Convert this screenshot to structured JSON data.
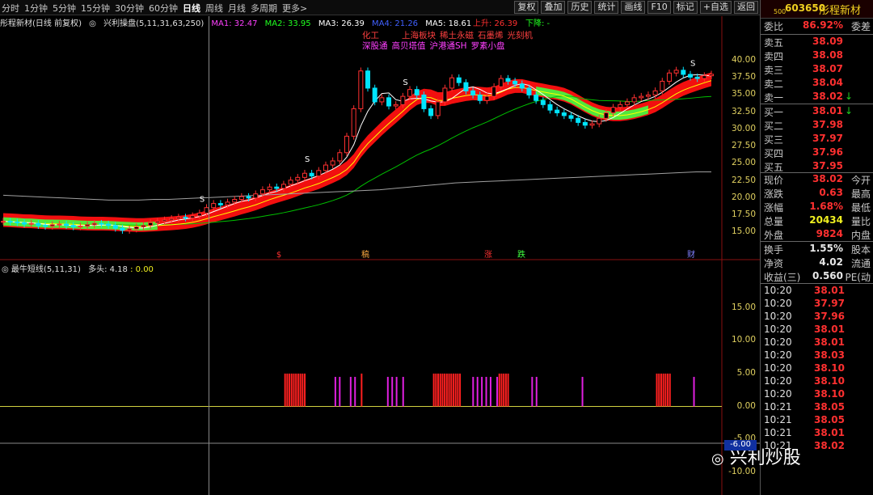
{
  "toolbar": {
    "timeframes": [
      "分时",
      "1分钟",
      "5分钟",
      "15分钟",
      "30分钟",
      "60分钟",
      "日线",
      "周线",
      "月线",
      "多周期",
      "更多>"
    ],
    "active": "日线",
    "right_buttons": [
      "复权",
      "叠加",
      "历史",
      "统计",
      "画线",
      "F10",
      "标记",
      "+自选",
      "返回"
    ]
  },
  "legend": {
    "stock_title": "彤程新材(日线 前复权)",
    "indicator": "兴利操盘(5,11,31,63,250)",
    "ma1": "MA1: 32.47",
    "ma2": "MA2: 33.95",
    "ma3": "MA3: 26.39",
    "ma4": "MA4: 21.26",
    "ma5": "MA5: 18.61",
    "up": "上升: 26.39",
    "down": "下降: -"
  },
  "news": {
    "line1": [
      "化工",
      "上海板块",
      "稀土永磁",
      "石墨烯",
      "光刻机"
    ],
    "line2": [
      "深股通",
      "高贝塔值",
      "沪港通SH",
      "罗素小盘"
    ]
  },
  "price_axis": [
    "40.00",
    "37.50",
    "35.00",
    "32.50",
    "30.00",
    "27.50",
    "25.00",
    "22.50",
    "20.00",
    "17.50",
    "15.00"
  ],
  "indicator_panel": {
    "title": "最牛短线(5,11,31)",
    "label": "多头: 4.18",
    "value": ": 0.00",
    "axis": [
      "15.00",
      "10.00",
      "5.00",
      "0.00",
      "-5.00",
      "-10.00"
    ],
    "marker": "-6.00"
  },
  "event_marks": [
    "$",
    "稿",
    "涨",
    "跌",
    "财"
  ],
  "chart_marks": {
    "s": "S",
    "b": "B"
  },
  "right_panel": {
    "header_big": "500",
    "code": "603650",
    "name": "彤程新材",
    "weibi_label": "委比",
    "weibi_value": "86.92%",
    "weicha_label": "委差",
    "asks": [
      {
        "label": "卖五",
        "price": "38.09"
      },
      {
        "label": "卖四",
        "price": "38.08"
      },
      {
        "label": "卖三",
        "price": "38.07"
      },
      {
        "label": "卖二",
        "price": "38.04"
      },
      {
        "label": "卖一",
        "price": "38.02"
      }
    ],
    "bids": [
      {
        "label": "买一",
        "price": "38.01"
      },
      {
        "label": "买二",
        "price": "37.98"
      },
      {
        "label": "买三",
        "price": "37.97"
      },
      {
        "label": "买四",
        "price": "37.96"
      },
      {
        "label": "买五",
        "price": "37.95"
      }
    ],
    "stats": [
      {
        "label": "现价",
        "value": "38.02",
        "extra": "今开"
      },
      {
        "label": "涨跌",
        "value": "0.63",
        "extra": "最高"
      },
      {
        "label": "涨幅",
        "value": "1.68%",
        "extra": "最低"
      },
      {
        "label": "总量",
        "value": "20434",
        "extra": "量比"
      },
      {
        "label": "外盘",
        "value": "9824",
        "extra": "内盘"
      }
    ],
    "stats2": [
      {
        "label": "换手",
        "value": "1.55%",
        "extra": "股本"
      },
      {
        "label": "净资",
        "value": "4.02",
        "extra": "流通"
      },
      {
        "label": "收益(三)",
        "value": "0.560",
        "extra": "PE(动"
      }
    ],
    "ticks": [
      {
        "time": "10:20",
        "price": "38.01"
      },
      {
        "time": "10:20",
        "price": "37.97"
      },
      {
        "time": "10:20",
        "price": "37.96"
      },
      {
        "time": "10:20",
        "price": "38.01"
      },
      {
        "time": "10:20",
        "price": "38.01"
      },
      {
        "time": "10:20",
        "price": "38.03"
      },
      {
        "time": "10:20",
        "price": "38.10"
      },
      {
        "time": "10:20",
        "price": "38.10"
      },
      {
        "time": "10:20",
        "price": "38.10"
      },
      {
        "time": "10:21",
        "price": "38.05"
      },
      {
        "time": "10:21",
        "price": "38.05"
      },
      {
        "time": "10:21",
        "price": "38.01"
      },
      {
        "time": "10:21",
        "price": "38.02"
      }
    ]
  },
  "watermark": "兴利炒股",
  "colors": {
    "up": "#ff3030",
    "down": "#00e5ff",
    "ma_white": "#ffffff",
    "ma_yellow": "#ffff00",
    "ma_green": "#00c000",
    "ma_grey": "#a0a0a0",
    "band_red": "#ff1010",
    "band_green": "#40ff40",
    "bar_red": "#ff2020",
    "bar_magenta": "#e020e0"
  },
  "chart_data": {
    "type": "candlestick",
    "closes": [
      16.6,
      16.5,
      16.4,
      16.2,
      16.3,
      16.0,
      15.9,
      16.1,
      16.2,
      16.0,
      15.8,
      15.9,
      16.1,
      16.3,
      16.2,
      16.0,
      15.6,
      15.3,
      15.5,
      15.8,
      16.0,
      16.4,
      16.6,
      16.8,
      17.0,
      17.2,
      17.1,
      17.4,
      17.8,
      18.6,
      19.2,
      19.0,
      19.4,
      19.8,
      20.2,
      20.0,
      20.6,
      21.2,
      21.6,
      21.4,
      22.0,
      22.6,
      23.0,
      23.6,
      23.2,
      24.0,
      24.8,
      25.4,
      26.6,
      29.0,
      33.0,
      38.5,
      36.0,
      34.0,
      34.6,
      33.4,
      33.6,
      34.8,
      35.8,
      35.0,
      33.0,
      32.0,
      34.0,
      36.0,
      37.5,
      36.8,
      35.6,
      35.0,
      34.2,
      34.8,
      36.2,
      37.4,
      37.0,
      36.6,
      36.0,
      35.0,
      34.2,
      33.6,
      32.8,
      32.4,
      32.0,
      31.6,
      31.0,
      30.6,
      30.8,
      31.6,
      32.4,
      33.2,
      33.6,
      34.0,
      34.6,
      34.8,
      35.0,
      35.6,
      37.0,
      38.2,
      38.6,
      38.0,
      37.6,
      37.4,
      37.8,
      38.02
    ],
    "ma": {
      "MA1": [
        16.5,
        16.3,
        16.2,
        16.1,
        16.0,
        16.0,
        15.9,
        15.9,
        16.0,
        16.1,
        16.1,
        15.9,
        15.8,
        15.9,
        16.1,
        16.3,
        17.0,
        17.8,
        18.6,
        19.3,
        20.0,
        20.8,
        21.6,
        22.6,
        23.4,
        24.4,
        25.8,
        28.0,
        31.0,
        33.6,
        34.6,
        34.6,
        34.6,
        35.0,
        35.2,
        35.0,
        34.2,
        34.0,
        35.4,
        36.0,
        35.6,
        34.8,
        34.8,
        35.8,
        36.2,
        35.4,
        34.2,
        33.0,
        32.0,
        31.2,
        31.6,
        32.4,
        33.4,
        34.4,
        35.4,
        36.6,
        37.6,
        37.6,
        37.8
      ],
      "MA5": [
        19.2,
        19.1,
        19.0,
        18.9,
        18.8,
        18.7,
        18.6,
        18.5,
        18.5,
        18.5,
        18.6,
        18.6,
        18.7,
        18.8,
        18.9,
        19.0,
        19.1,
        19.2,
        19.3,
        19.4,
        19.5,
        19.6,
        19.7,
        19.8,
        19.9,
        20.0,
        20.2,
        20.4,
        20.6,
        20.8,
        21.0,
        21.1,
        21.2,
        21.3,
        21.4,
        21.5,
        21.6,
        21.7,
        21.8,
        21.9,
        22.0,
        22.1,
        22.2,
        22.3,
        22.4,
        22.5,
        22.6,
        22.6
      ]
    },
    "ylim": [
      13.5,
      42.0
    ],
    "indicator": {
      "values": [
        0,
        0,
        0,
        0,
        0,
        0,
        0,
        0,
        0,
        0,
        0,
        0,
        0,
        0,
        0,
        0,
        0,
        0,
        0,
        0,
        0,
        0,
        0,
        0,
        0,
        0,
        0,
        0,
        0,
        0,
        0,
        0,
        0,
        0,
        0,
        0,
        0,
        0,
        0,
        0,
        0,
        0,
        0,
        0,
        0,
        0,
        0,
        0,
        0,
        0,
        0,
        0,
        5,
        5,
        5,
        5,
        5,
        5,
        5,
        5,
        5,
        5,
        0,
        0,
        0,
        0,
        0,
        0,
        0,
        0,
        0,
        0,
        0,
        0,
        0,
        4.5,
        0,
        4.5,
        0,
        0,
        0,
        0,
        4.5,
        0,
        4.5,
        0,
        0,
        5,
        0,
        0,
        0,
        0,
        0,
        0,
        0,
        0,
        0,
        0,
        0,
        4.5,
        0,
        4.5,
        0,
        4.5,
        0,
        0,
        4.5,
        0,
        0,
        0,
        0,
        0,
        0,
        0,
        0,
        0,
        0,
        0,
        0,
        0,
        5,
        5,
        5,
        5,
        5,
        5,
        5,
        5,
        5,
        5,
        5,
        5,
        5,
        0,
        0,
        0,
        0,
        0,
        4.5,
        0,
        4.5,
        0,
        4.5,
        0,
        4.5,
        0,
        4.5,
        0,
        0,
        4.5,
        5,
        5,
        5,
        5,
        5,
        0,
        0,
        0,
        0,
        0,
        0,
        0,
        0,
        0,
        0,
        4.5,
        0,
        4.5,
        0,
        0,
        0,
        0,
        0,
        0,
        0,
        0,
        0,
        0,
        0,
        0,
        0,
        0,
        0,
        0,
        0,
        0,
        0,
        0,
        4.5,
        0,
        0,
        0,
        0,
        0,
        0,
        0,
        0,
        0,
        0,
        0,
        0,
        0,
        0,
        0,
        0,
        0,
        0,
        0,
        0,
        0,
        0,
        0,
        0,
        0,
        0,
        0,
        0,
        0,
        0,
        0,
        0,
        0,
        5,
        5,
        5,
        5,
        5,
        5,
        5,
        0,
        0,
        0,
        0,
        0,
        0,
        0,
        0,
        0,
        0,
        4.5,
        0,
        0,
        0
      ],
      "ylim": [
        -12,
        20
      ]
    }
  }
}
